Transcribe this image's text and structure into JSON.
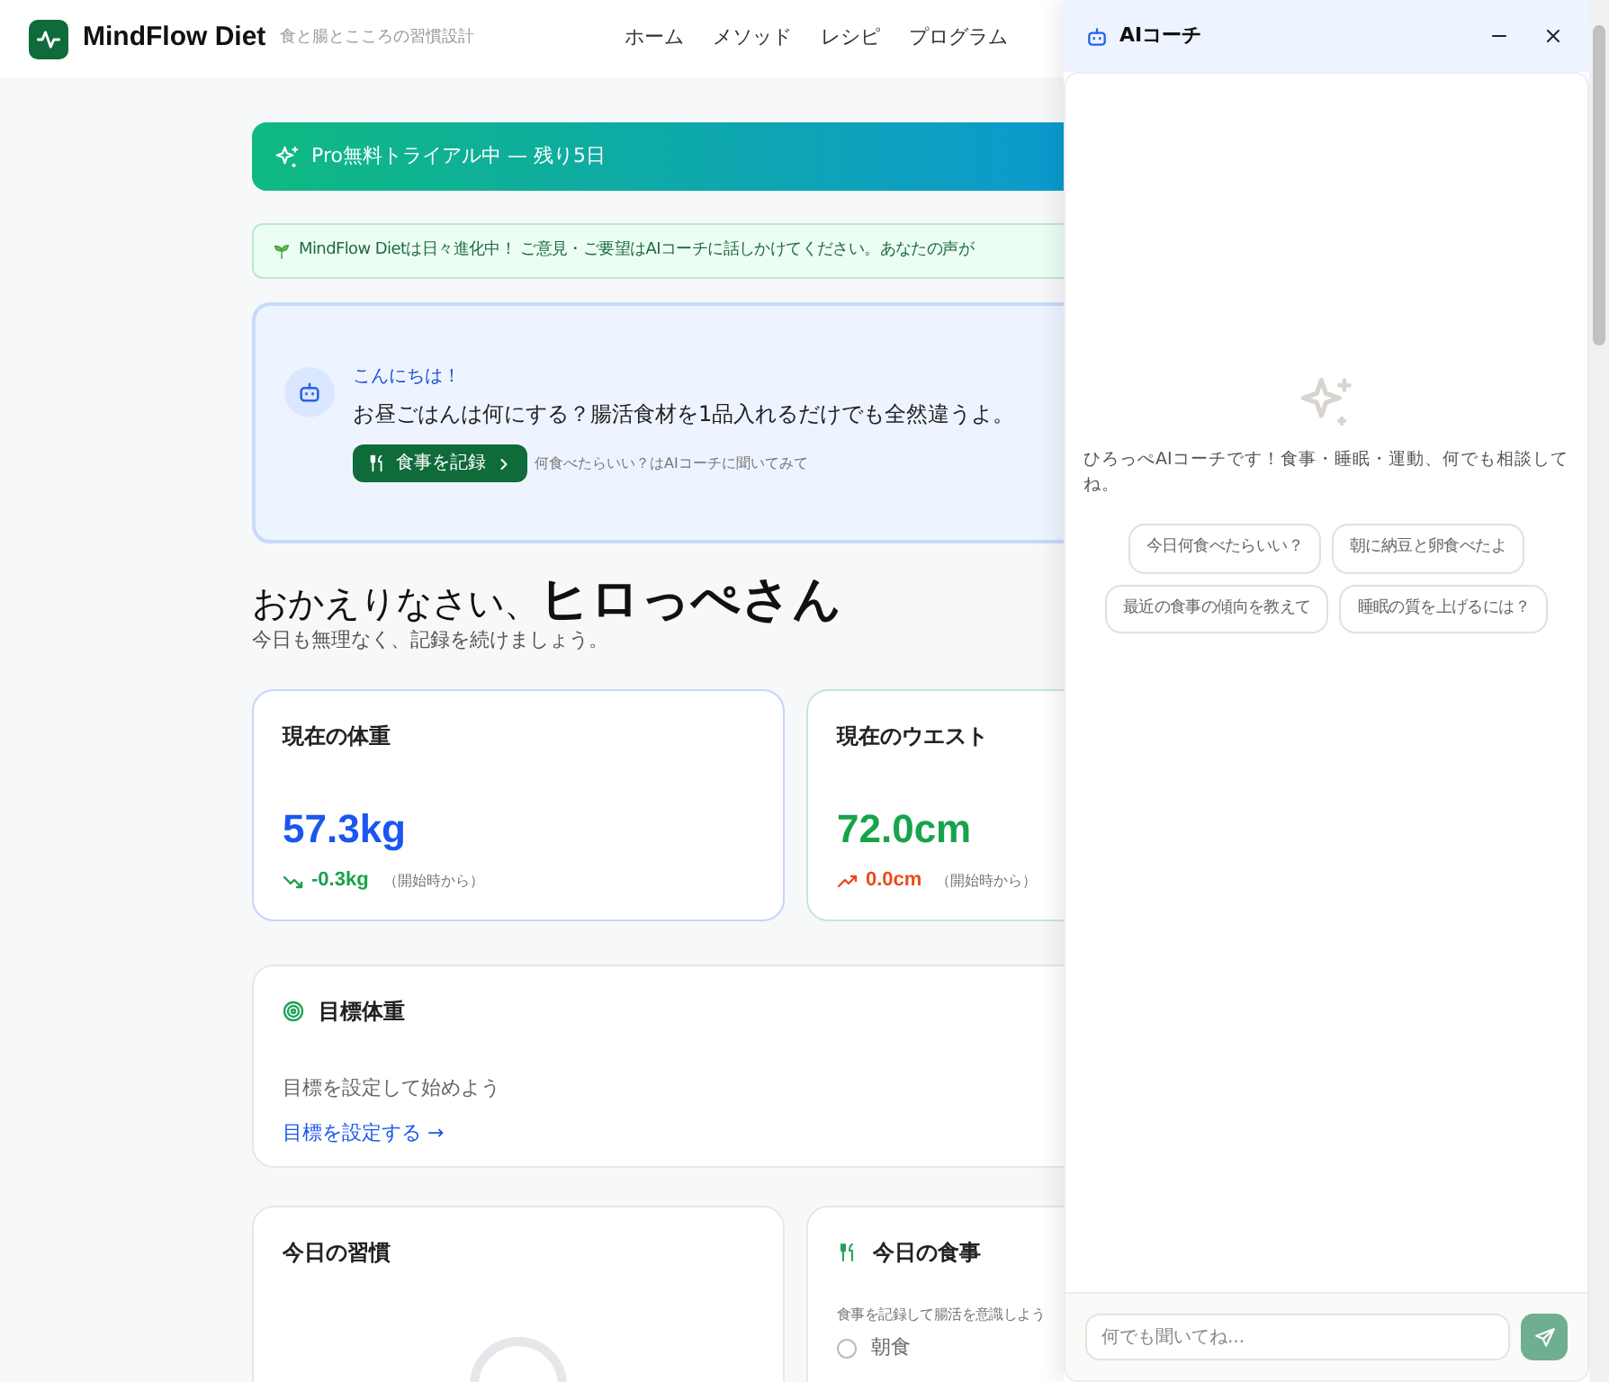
{
  "header": {
    "logo_text": "MindFlow Diet",
    "tagline": "食と腸とこころの習慣設計",
    "nav": [
      "ホーム",
      "メソッド",
      "レシピ",
      "プログラム"
    ]
  },
  "trial_banner": {
    "text": "Pro無料トライアル中 — 残り5日"
  },
  "feedback_banner": {
    "text": "MindFlow Dietは日々進化中！ ご意見・ご要望はAIコーチに話しかけてください。あなたの声が"
  },
  "greeting": {
    "title": "こんにちは！",
    "message": "お昼ごはんは何にする？腸活食材を1品入れるだけでも全然違うよ。",
    "button": "食事を記録",
    "hint": "何食べたらいい？はAIコーチに聞いてみて"
  },
  "welcome": {
    "prefix": "おかえりなさい、",
    "name": "ヒロっぺさん",
    "subtitle": "今日も無理なく、記録を続けましょう。"
  },
  "stats": [
    {
      "label": "現在の体重",
      "value": "57.3kg",
      "change": "-0.3kg",
      "note": "（開始時から）",
      "kind": "down",
      "color": "#1a56f0"
    },
    {
      "label": "現在のウエスト",
      "value": "72.0cm",
      "change": "0.0cm",
      "note": "（開始時から）",
      "kind": "up",
      "color": "#16a34a"
    }
  ],
  "goal": {
    "title": "目標体重",
    "text": "目標を設定して始めよう",
    "link": "目標を設定する →"
  },
  "habits": {
    "title": "今日の習慣"
  },
  "meals": {
    "title": "今日の食事",
    "text": "食事を記録して腸活を意識しよう",
    "items": [
      {
        "label": "朝食",
        "checked": false
      }
    ]
  },
  "coach": {
    "title": "AIコーチ",
    "intro": "ひろっぺAIコーチです！食事・睡眠・運動、何でも相談してね。",
    "suggestions": [
      "今日何食べたらいい？",
      "朝に納豆と卵食べたよ",
      "最近の食事の傾向を教えて",
      "睡眠の質を上げるには？"
    ],
    "placeholder": "何でも聞いてね..."
  }
}
